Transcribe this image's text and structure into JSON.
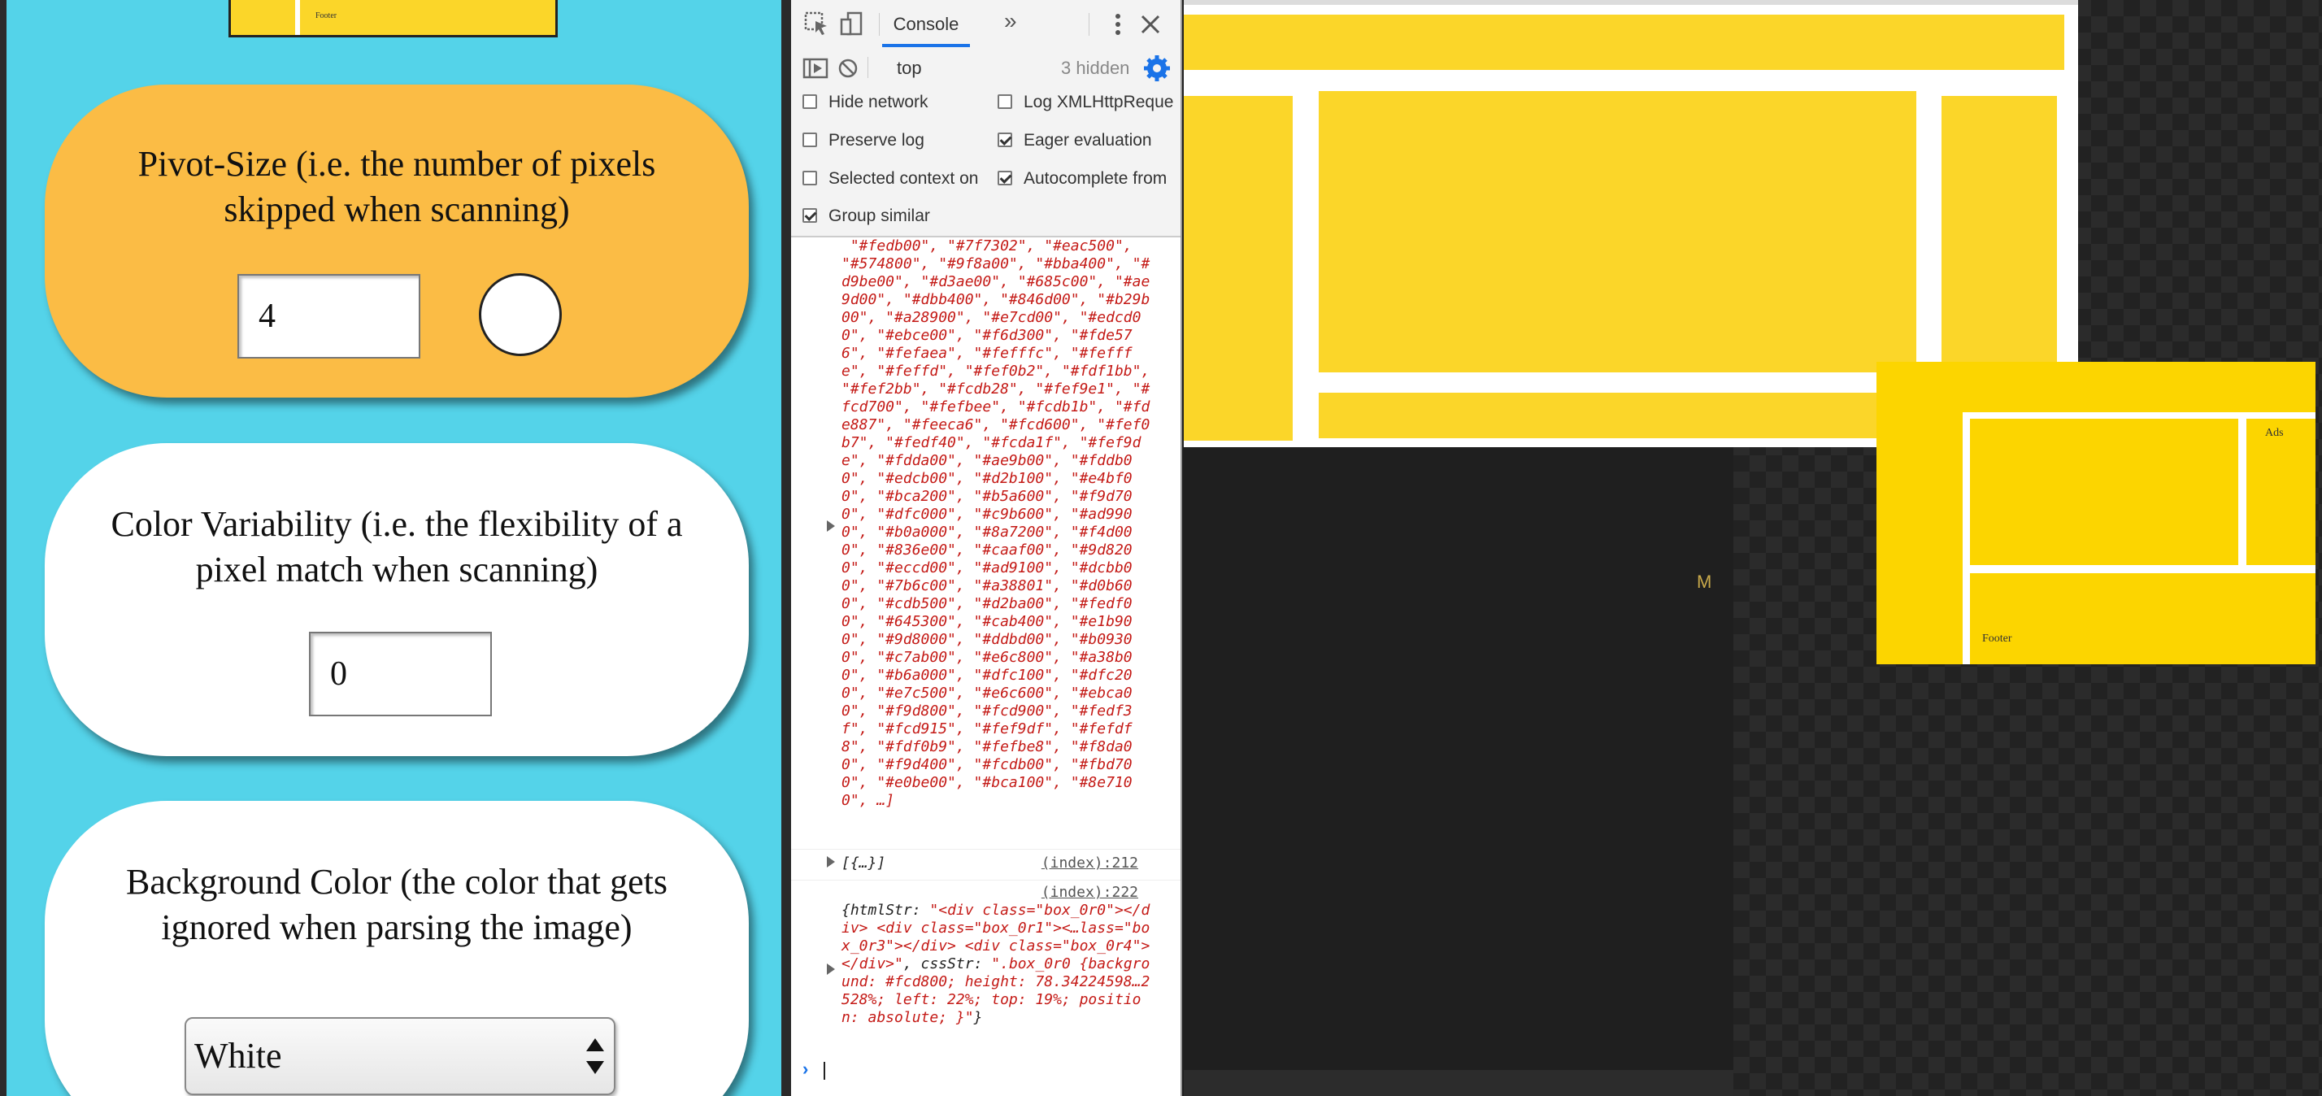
{
  "app": {
    "mini_footer_label": "Footer",
    "pivot_card": {
      "label": "Pivot-Size (i.e. the number of pixels skipped when scanning)",
      "value": "4",
      "bg_color": "#fbbc45"
    },
    "variability_card": {
      "label": "Color Variability (i.e. the flexibility of a pixel match when scanning)",
      "value": "0",
      "bg_color": "#ffffff"
    },
    "background_card": {
      "label": "Background Color (the color that gets ignored when parsing the image)",
      "selected": "White",
      "bg_color": "#ffffff"
    },
    "panel_color": "#54d3e9"
  },
  "devtools": {
    "tabs": {
      "console": "Console",
      "more": "»"
    },
    "filter": {
      "context": "top",
      "hidden_count": "3 hidden"
    },
    "settings": {
      "hide_network": "Hide network",
      "log_xhr": "Log XMLHttpReque",
      "preserve_log": "Preserve log",
      "eager_eval": "Eager evaluation",
      "selected_context": "Selected context on",
      "autocomplete": "Autocomplete from",
      "group_similar": "Group similar",
      "checked": {
        "hide_network": false,
        "log_xhr": false,
        "preserve_log": false,
        "eager_eval": true,
        "selected_context": false,
        "autocomplete": true,
        "group_similar": true
      }
    },
    "array_output": " \"#fedb00\", \"#7f7302\", \"#eac500\", \"#574800\", \"#9f8a00\", \"#bba400\", \"#d9be00\", \"#d3ae00\", \"#685c00\", \"#ae9d00\", \"#dbb400\", \"#846d00\", \"#b29b00\", \"#a28900\", \"#e7cd00\", \"#edcd00\", \"#ebce00\", \"#f6d300\", \"#fde576\", \"#fefaea\", \"#fefffc\", \"#fefffe\", \"#feffd\", \"#fef0b2\", \"#fdf1bb\", \"#fef2bb\", \"#fcdb28\", \"#fef9e1\", \"#fcd700\", \"#fefbee\", \"#fcdb1b\", \"#fde887\", \"#feeca6\", \"#fcd600\", \"#fef0b7\", \"#fedf40\", \"#fcda1f\", \"#fef9de\", \"#fdda00\", \"#ae9b00\", \"#fddb00\", \"#edcb00\", \"#d2b100\", \"#e4bf00\", \"#bca200\", \"#b5a600\", \"#f9d700\", \"#dfc000\", \"#c9b600\", \"#ad9900\", \"#b0a000\", \"#8a7200\", \"#f4d000\", \"#836e00\", \"#caaf00\", \"#9d8200\", \"#eccd00\", \"#ad9100\", \"#dcbb00\", \"#7b6c00\", \"#a38801\", \"#d0b600\", \"#cdb500\", \"#d2ba00\", \"#fedf00\", \"#645300\", \"#cab400\", \"#e1b900\", \"#9d8000\", \"#ddbd00\", \"#b09300\", \"#c7ab00\", \"#e6c800\", \"#a38b00\", \"#b6a000\", \"#dfc100\", \"#dfc200\", \"#e7c500\", \"#e6c600\", \"#ebca00\", \"#f9d800\", \"#fcd900\", \"#fedf3f\", \"#fcd915\", \"#fef9df\", \"#fefdf8\", \"#fdf0b9\", \"#fefbe8\", \"#f8da00\", \"#f9d400\", \"#fcdb00\", \"#fbd700\", \"#e0be00\", \"#bca100\", \"#8e7100\", …]",
    "log1": {
      "text": "[{…}]",
      "source": "(index):212"
    },
    "log2": {
      "source": "(index):222",
      "key1": "htmlStr",
      "value1": "\"<div class=\"box_0r0\"></div> <div class=\"box_0r1\"><…lass=\"box_0r3\"></div> <div class=\"box_0r4\"></div>\"",
      "key2": "cssStr",
      "value2": "\".box_0r0 {background: #fcd800; height: 78.34224598…2528%; left: 22%; top: 19%; position: absolute; }\""
    }
  },
  "preview": {
    "box_color": "#fbd629",
    "dark_label": "M"
  },
  "thumbnail": {
    "box_color": "#fcd500",
    "ads_label": "Ads",
    "footer_label": "Footer"
  }
}
